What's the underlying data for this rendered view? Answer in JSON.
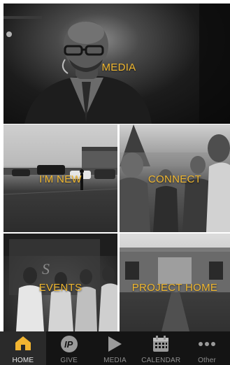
{
  "tiles": {
    "media": {
      "label": "MEDIA"
    },
    "new": {
      "label": "I'M NEW"
    },
    "connect": {
      "label": "CONNECT"
    },
    "events": {
      "label": "EVENTS"
    },
    "project_home": {
      "label": "PROJECT HOME"
    }
  },
  "tabbar": {
    "tabs": [
      {
        "label": "HOME",
        "icon": "home-icon",
        "active": true
      },
      {
        "label": "GIVE",
        "icon": "give-icon",
        "active": false
      },
      {
        "label": "MEDIA",
        "icon": "play-icon",
        "active": false
      },
      {
        "label": "CALENDAR",
        "icon": "calendar-icon",
        "active": false
      },
      {
        "label": "Other",
        "icon": "more-icon",
        "active": false
      }
    ]
  },
  "colors": {
    "label_accent": "#f0b72f",
    "tabbar_bg": "#141414",
    "tab_active_bg": "#2a2a2a",
    "home_icon": "#f2b531"
  }
}
